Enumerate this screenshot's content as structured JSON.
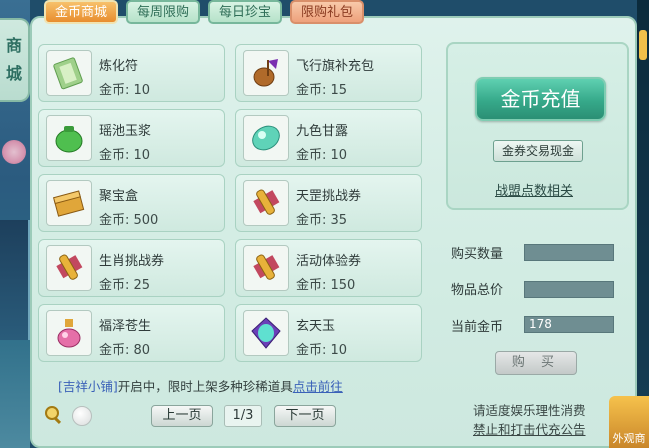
{
  "side": {
    "tab_label_1": "商",
    "tab_label_2": "城"
  },
  "tabs": [
    {
      "label": "金币商城",
      "active": true
    },
    {
      "label": "每周限购",
      "active": false
    },
    {
      "label": "每日珍宝",
      "active": false
    },
    {
      "label": "限购礼包",
      "active": false
    }
  ],
  "items": [
    {
      "name": "炼化符",
      "price": "金币: 10",
      "icon": "talisman-icon"
    },
    {
      "name": "飞行旗补充包",
      "price": "金币: 15",
      "icon": "flag-pouch-icon"
    },
    {
      "name": "瑶池玉浆",
      "price": "金币: 10",
      "icon": "jade-jar-icon"
    },
    {
      "name": "九色甘露",
      "price": "金币: 10",
      "icon": "dew-gem-icon"
    },
    {
      "name": "聚宝盒",
      "price": "金币: 500",
      "icon": "treasure-box-icon"
    },
    {
      "name": "天罡挑战券",
      "price": "金币: 35",
      "icon": "scroll-icon"
    },
    {
      "name": "生肖挑战券",
      "price": "金币: 25",
      "icon": "scroll-icon"
    },
    {
      "name": "活动体验券",
      "price": "金币: 150",
      "icon": "scroll-icon"
    },
    {
      "name": "福泽苍生",
      "price": "金币: 80",
      "icon": "potion-icon"
    },
    {
      "name": "玄天玉",
      "price": "金币: 10",
      "icon": "jade-icon"
    }
  ],
  "notice": {
    "tag": "[吉祥小铺]",
    "text": "开启中，限时上架多种珍稀道具",
    "link": "点击前往"
  },
  "pagination": {
    "prev": "上一页",
    "page": "1/3",
    "next": "下一页"
  },
  "right": {
    "recharge": "金币充值",
    "exchange": "金券交易现金",
    "alliance": "战盟点数相关",
    "qty_label": "购买数量",
    "qty_value": "",
    "total_label": "物品总价",
    "total_value": "",
    "gold_label": "当前金币",
    "gold_value": "178",
    "buy": "购 买"
  },
  "health": {
    "line1": "请适度娱乐理性消费",
    "line2": "禁止和打击代充公告"
  },
  "corner": {
    "label": "外观商"
  }
}
